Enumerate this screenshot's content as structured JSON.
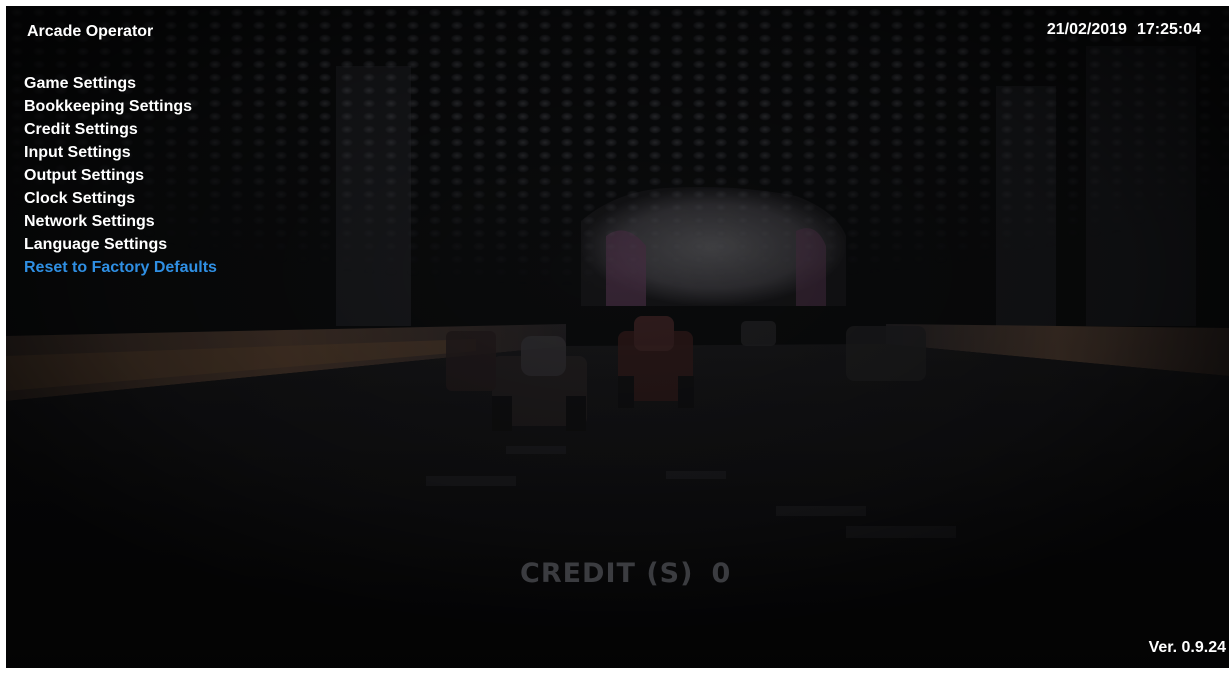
{
  "header": {
    "app_title": "Arcade Operator",
    "date": "21/02/2019",
    "time": "17:25:04"
  },
  "menu": {
    "items": [
      {
        "label": "Game Settings",
        "selected": false
      },
      {
        "label": "Bookkeeping Settings",
        "selected": false
      },
      {
        "label": "Credit Settings",
        "selected": false
      },
      {
        "label": "Input Settings",
        "selected": false
      },
      {
        "label": "Output Settings",
        "selected": false
      },
      {
        "label": "Clock Settings",
        "selected": false
      },
      {
        "label": "Network Settings",
        "selected": false
      },
      {
        "label": "Language Settings",
        "selected": false
      },
      {
        "label": "Reset to Factory Defaults",
        "selected": true
      }
    ],
    "selected_color": "#2f8fe3"
  },
  "hud": {
    "credit_label": "CREDIT (S)",
    "credit_value": "0"
  },
  "footer": {
    "version": "Ver. 0.9.24"
  }
}
